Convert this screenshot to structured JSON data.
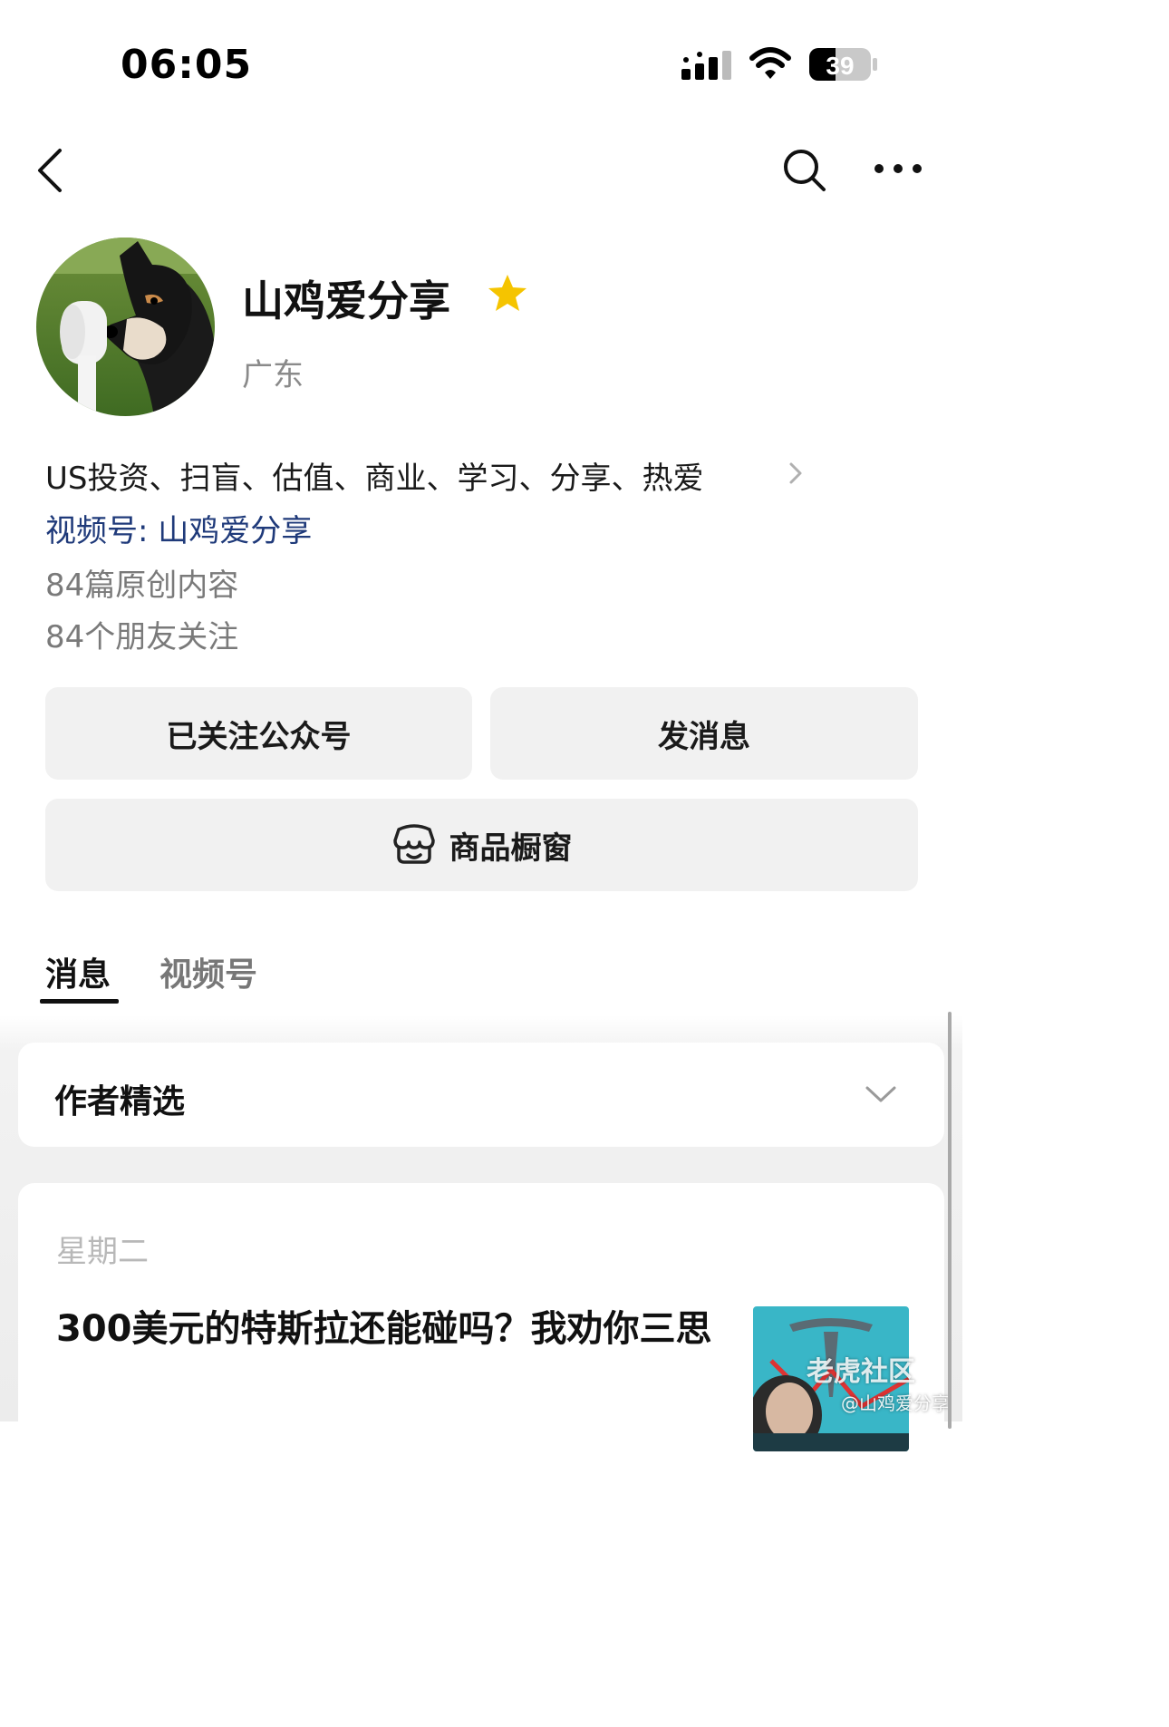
{
  "status_bar": {
    "time": "06:05",
    "battery": "39"
  },
  "nav": {
    "back_icon": "chevron-left-icon",
    "search_icon": "search-icon",
    "more_icon": "more-dots-icon"
  },
  "profile": {
    "name": "山鸡爱分享",
    "region": "广东",
    "bio": "US投资、扫盲、估值、商业、学习、分享、热爱",
    "channel": "视频号: 山鸡爱分享",
    "original_count": "84篇原创内容",
    "friends_follow": "84个朋友关注",
    "star_color": "#F5C400"
  },
  "actions": {
    "follow_label": "已关注公众号",
    "message_label": "发消息",
    "shop_label": "商品橱窗"
  },
  "tabs": [
    {
      "label": "消息",
      "active": true
    },
    {
      "label": "视频号",
      "active": false
    }
  ],
  "author_pick": {
    "title": "作者精选"
  },
  "articles": [
    {
      "day": "星期二",
      "title": "300美元的特斯拉还能碰吗？我劝你三思"
    }
  ],
  "watermark": {
    "logo": "老虎社区",
    "user": "@山鸡爱分享"
  }
}
